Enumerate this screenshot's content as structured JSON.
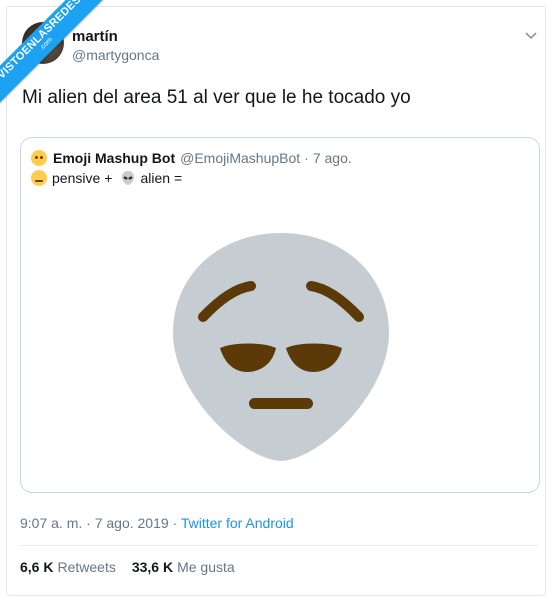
{
  "watermark": {
    "main": "VISTOENLASREDES",
    "sub": ".com"
  },
  "author": {
    "name": "martín",
    "handle": "@martygonca"
  },
  "tweet": {
    "text": "Mi alien del area 51 al ver que le he tocado yo"
  },
  "quote": {
    "name": "Emoji Mashup Bot",
    "handle": "@EmojiMashupBot",
    "separator": "·",
    "date": "7 ago.",
    "word1": "pensive",
    "plus": "+",
    "word2": "alien",
    "equals": "="
  },
  "meta": {
    "time": "9:07 a. m. · 7 ago. 2019 · ",
    "source": "Twitter for Android"
  },
  "stats": {
    "retweets_count": "6,6 K",
    "retweets_label": "Retweets",
    "likes_count": "33,6 K",
    "likes_label": "Me gusta"
  },
  "colors": {
    "accent": "#1da1f2",
    "alien_skin": "#c5cdd3",
    "pensive_features": "#5c3a08"
  },
  "icons": [
    "chevron-down-icon",
    "pensive-emoji-icon",
    "alien-emoji-icon",
    "pensive-alien-mashup-image"
  ]
}
